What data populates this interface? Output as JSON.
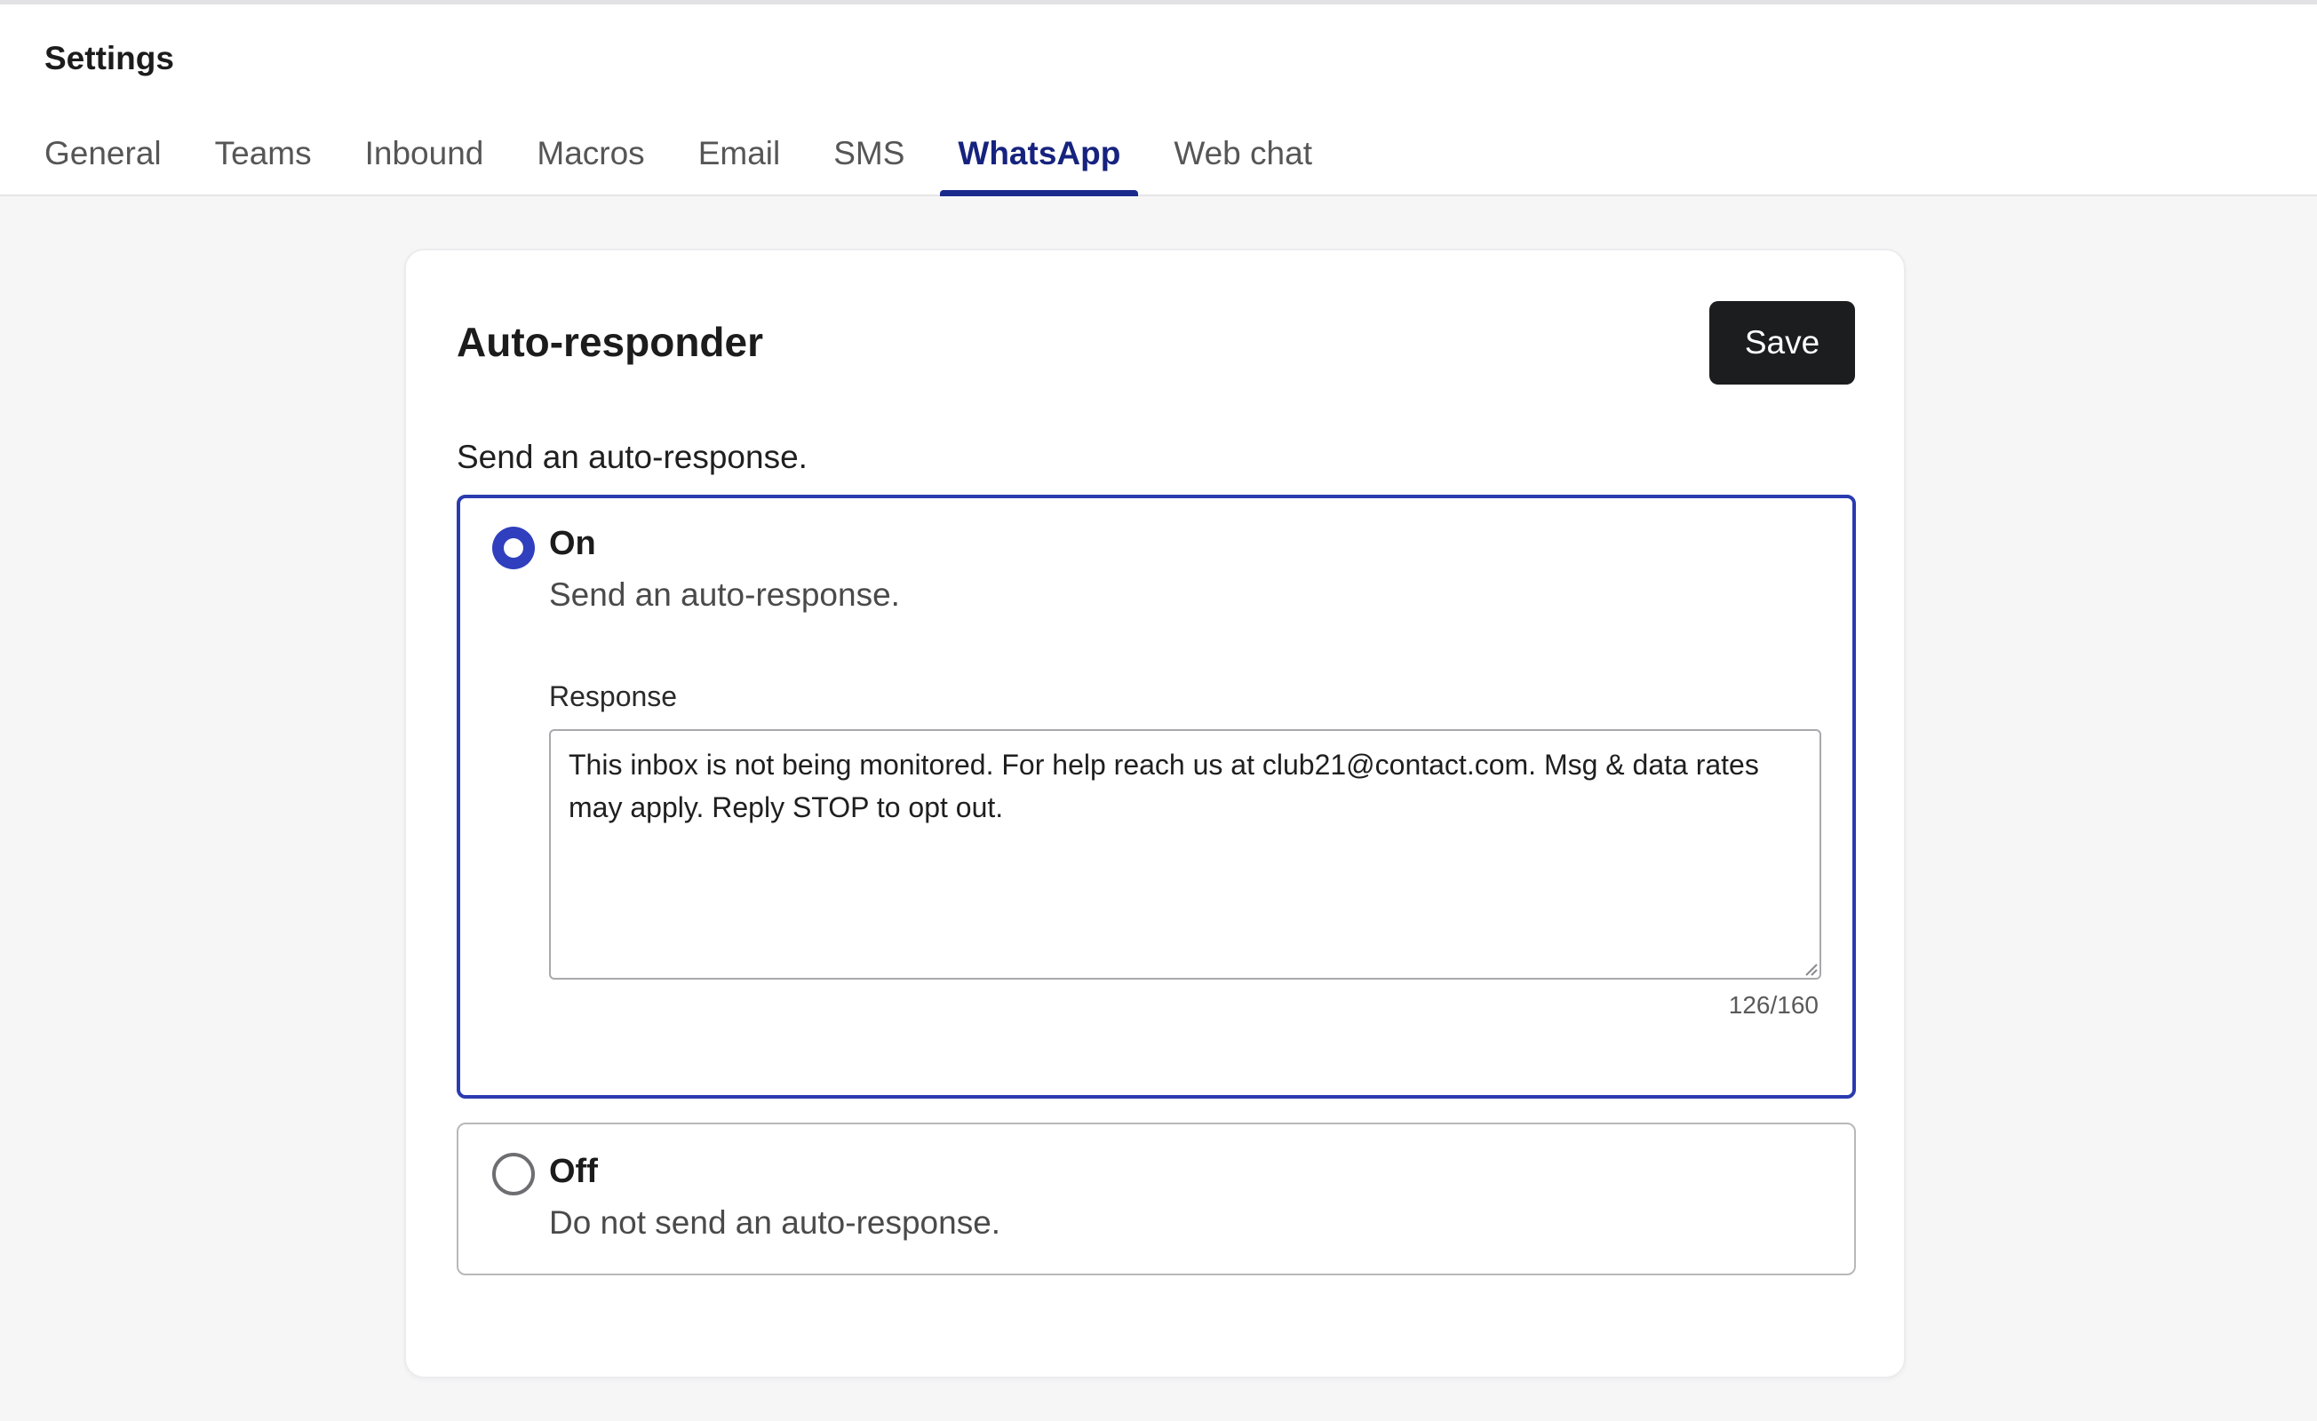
{
  "header": {
    "title": "Settings",
    "tabs": [
      {
        "label": "General",
        "active": false
      },
      {
        "label": "Teams",
        "active": false
      },
      {
        "label": "Inbound",
        "active": false
      },
      {
        "label": "Macros",
        "active": false
      },
      {
        "label": "Email",
        "active": false
      },
      {
        "label": "SMS",
        "active": false
      },
      {
        "label": "WhatsApp",
        "active": true
      },
      {
        "label": "Web chat",
        "active": false
      }
    ]
  },
  "card": {
    "title": "Auto-responder",
    "save_label": "Save",
    "intro": "Send an auto-response.",
    "options": {
      "on": {
        "label": "On",
        "description": "Send an auto-response.",
        "selected": true,
        "response_label": "Response",
        "response_value": "This inbox is not being monitored. For help reach us at club21@contact.com. Msg & data rates may apply. Reply STOP to opt out.",
        "counter": "126/160"
      },
      "off": {
        "label": "Off",
        "description": "Do not send an auto-response.",
        "selected": false
      }
    }
  },
  "colors": {
    "accent": "#2f3fbe",
    "active_tab": "#16237e",
    "save_button": "#1c1d1f"
  }
}
